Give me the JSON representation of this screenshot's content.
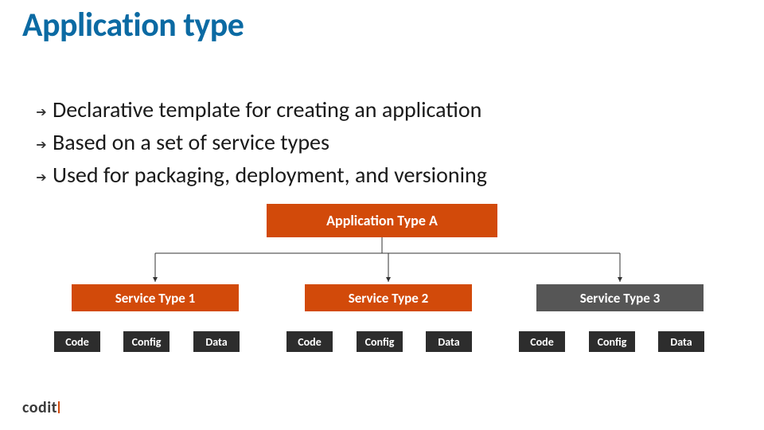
{
  "title": "Application type",
  "bullets": [
    "Declarative template for creating an application",
    "Based on a set of service types",
    "Used for packaging, deployment, and versioning"
  ],
  "diagram": {
    "root": "Application Type A",
    "services": [
      {
        "label": "Service Type 1",
        "leaves": [
          "Code",
          "Config",
          "Data"
        ]
      },
      {
        "label": "Service Type 2",
        "leaves": [
          "Code",
          "Config",
          "Data"
        ]
      },
      {
        "label": "Service Type 3",
        "leaves": [
          "Code",
          "Config",
          "Data"
        ]
      }
    ]
  },
  "logo": "codit"
}
